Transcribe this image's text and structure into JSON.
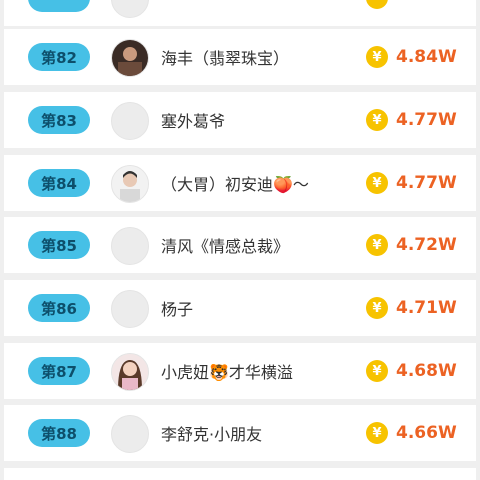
{
  "ranking": {
    "coin_symbol": "¥",
    "colors": {
      "rank_badge": "#46c0e6",
      "amount": "#ec6223",
      "coin": "#f7c300"
    },
    "rows": [
      {
        "rank": "",
        "name": "",
        "amount": "",
        "avatar": "default-avatar",
        "partial": true
      },
      {
        "rank": "第82",
        "name": "海丰（翡翠珠宝）",
        "amount": "4.84W",
        "avatar": "photo-avatar"
      },
      {
        "rank": "第83",
        "name": "塞外葛爷",
        "amount": "4.77W",
        "avatar": "default-avatar"
      },
      {
        "rank": "第84",
        "name": "（大胃）初安迪🍑～",
        "amount": "4.77W",
        "avatar": "photo-avatar"
      },
      {
        "rank": "第85",
        "name": "清风《情感总裁》",
        "amount": "4.72W",
        "avatar": "default-avatar"
      },
      {
        "rank": "第86",
        "name": "杨子",
        "amount": "4.71W",
        "avatar": "default-avatar"
      },
      {
        "rank": "第87",
        "name": "小虎妞🐯才华横溢",
        "amount": "4.68W",
        "avatar": "photo-avatar"
      },
      {
        "rank": "第88",
        "name": "李舒克·小朋友",
        "amount": "4.66W",
        "avatar": "default-avatar"
      }
    ]
  }
}
